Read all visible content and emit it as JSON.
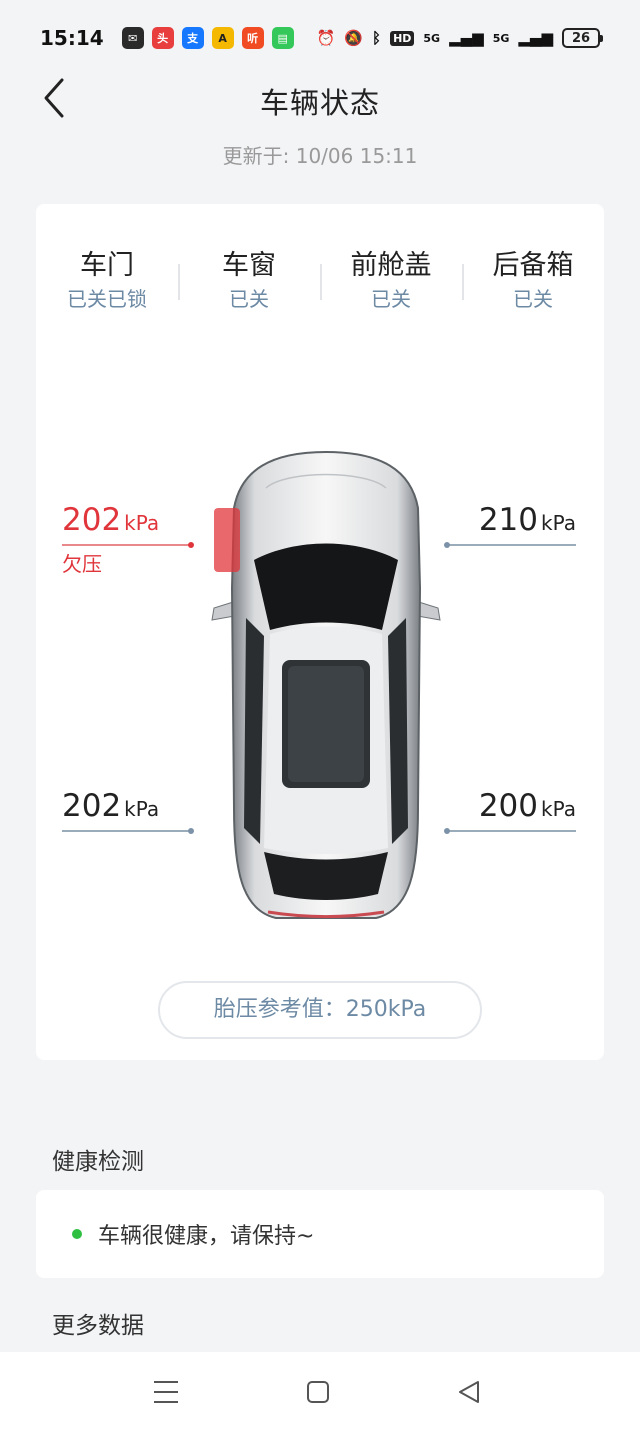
{
  "status_bar": {
    "time": "15:14",
    "notif_icons": [
      {
        "name": "wechat-icon",
        "glyph": "✉",
        "color": "#2a2a2a"
      },
      {
        "name": "toutiao-icon",
        "glyph": "头",
        "color": "#e83e3e"
      },
      {
        "name": "alipay-icon",
        "glyph": "支",
        "color": "#1677ff"
      },
      {
        "name": "navigation-app-icon",
        "glyph": "A",
        "color": "#f5b800"
      },
      {
        "name": "listen-app-icon",
        "glyph": "听",
        "color": "#f04b23"
      },
      {
        "name": "message-icon",
        "glyph": "▤",
        "color": "#34c759"
      }
    ],
    "network_label": "5G",
    "hd_label": "HD",
    "battery": "26"
  },
  "header": {
    "title": "车辆状态",
    "updated": "更新于: 10/06 15:11"
  },
  "status_items": [
    {
      "name": "车门",
      "value": "已关已锁"
    },
    {
      "name": "车窗",
      "value": "已关"
    },
    {
      "name": "前舱盖",
      "value": "已关"
    },
    {
      "name": "后备箱",
      "value": "已关"
    }
  ],
  "tires": {
    "front_left": {
      "value": "202",
      "unit": "kPa",
      "note": "欠压"
    },
    "front_right": {
      "value": "210",
      "unit": "kPa"
    },
    "rear_left": {
      "value": "202",
      "unit": "kPa"
    },
    "rear_right": {
      "value": "200",
      "unit": "kPa"
    }
  },
  "reference": "胎压参考值：250kPa",
  "health": {
    "title": "健康检测",
    "message": "车辆很健康，请保持~"
  },
  "more_data_title": "更多数据",
  "colors": {
    "warning": "#e0353b",
    "accent": "#6d8aa5",
    "healthy": "#2fbf42"
  }
}
